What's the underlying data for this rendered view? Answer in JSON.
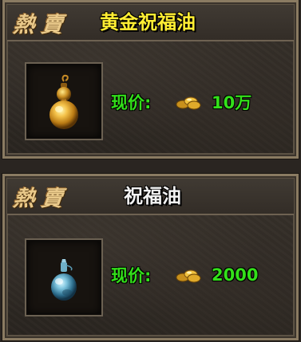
{
  "cards": [
    {
      "badge": [
        "熱",
        "賣"
      ],
      "title": "黄金祝福油",
      "item_icon": "golden-gourd-bottle-icon",
      "price_label": "现价:",
      "currency_icon": "gold-coins-icon",
      "price_value": "10万"
    },
    {
      "badge": [
        "熱",
        "賣"
      ],
      "title": "祝福油",
      "item_icon": "blue-potion-bottle-icon",
      "price_label": "现价:",
      "currency_icon": "gold-coins-icon",
      "price_value": "2000"
    }
  ],
  "colors": {
    "title_gold": "#ffee33",
    "title_white": "#f2f2f2",
    "price_green": "#33e01a",
    "badge": "#e9c98a"
  }
}
